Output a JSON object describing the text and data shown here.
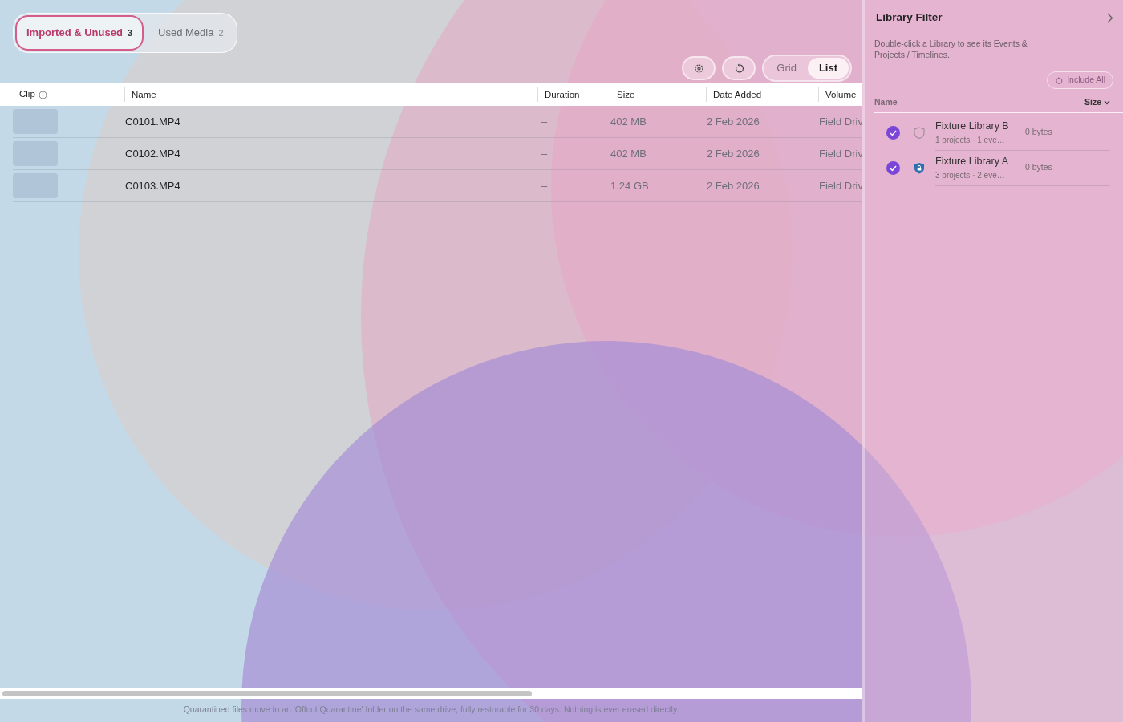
{
  "segments": [
    {
      "label": "Imported & Unused",
      "count": "3",
      "selected": true
    },
    {
      "label": "Used Media",
      "count": "2",
      "selected": false
    }
  ],
  "view_modes": [
    {
      "label": "Grid",
      "selected": false
    },
    {
      "label": "List",
      "selected": true
    }
  ],
  "table": {
    "columns": [
      "Clip",
      "Name",
      "Duration",
      "Size",
      "Date Added",
      "Volume"
    ],
    "rows": [
      {
        "name": "C0101.MP4",
        "duration": "–",
        "size": "402 MB",
        "date_added": "2 Feb 2026",
        "volume": "Field Driv"
      },
      {
        "name": "C0102.MP4",
        "duration": "–",
        "size": "402 MB",
        "date_added": "2 Feb 2026",
        "volume": "Field Driv"
      },
      {
        "name": "C0103.MP4",
        "duration": "–",
        "size": "1.24 GB",
        "date_added": "2 Feb 2026",
        "volume": "Field Driv"
      }
    ]
  },
  "footer_note": "Quarantined files move to an 'Offcut Quarantine' folder on the same drive, fully restorable for 30 days. Nothing is ever erased directly.",
  "sidebar": {
    "title": "Library Filter",
    "description": "Double-click a Library to see its Events & Projects / Timelines.",
    "include_all": {
      "label": "Include All",
      "disabled": true
    },
    "columns": [
      "Name",
      "Size"
    ],
    "libraries": [
      {
        "name": "Fixture Library B",
        "summary": "1 projects · 1 eve…",
        "size": "0 bytes",
        "checked": true,
        "locked": false
      },
      {
        "name": "Fixture Library A",
        "summary": "3 projects · 2 eve…",
        "size": "0 bytes",
        "checked": true,
        "locked": true
      }
    ]
  }
}
